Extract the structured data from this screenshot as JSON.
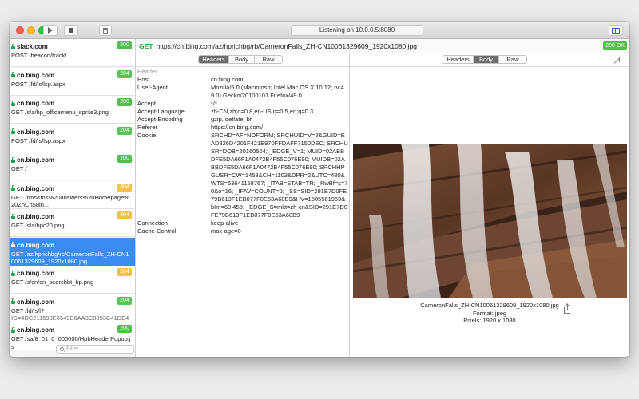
{
  "titlebar": {
    "status": "Listening on 10.0.0.5:8080",
    "icons": {
      "play": "play-icon",
      "stop": "stop-icon",
      "trash": "trash-icon",
      "split": "split-view-icon"
    }
  },
  "sidebar": {
    "items": [
      {
        "host": "slack.com",
        "path": "POST /beacon/track/",
        "status": "200",
        "secure": true
      },
      {
        "host": "cn.bing.com",
        "path": "POST /fd/ls/lsp.aspx",
        "status": "204",
        "secure": true
      },
      {
        "host": "cn.bing.com",
        "path": "GET /s/a/hp_officemenu_sprite3.png",
        "status": "200",
        "secure": true
      },
      {
        "host": "cn.bing.com",
        "path": "POST /fd/ls/lsp.aspx",
        "status": "204",
        "secure": true
      },
      {
        "host": "cn.bing.com",
        "path": "GET /",
        "status": "200",
        "secure": true
      },
      {
        "host": "cn.bing.com",
        "path": "GET /rms/rms%20answers%20Homepage%20ZhCn$8in...",
        "status": "304",
        "secure": true
      },
      {
        "host": "cn.bing.com",
        "path": "GET /s/a/hpc20.png",
        "status": "304",
        "secure": true
      },
      {
        "host": "cn.bing.com",
        "path": "GET /az/hprichbg/rb/CameronFalls_ZH-CN10061329609_1920x1080.jpg",
        "status": "200",
        "secure": true,
        "selected": true
      },
      {
        "host": "cn.bing.com",
        "path": "GET /s/cn/cn_searchbt_hp.png",
        "status": "304",
        "secure": true
      },
      {
        "host": "cn.bing.com",
        "path": "GET /fd/ls/l?",
        "path2": "IG=4DC211598E6549B6AA3C8893C41DE48...",
        "status": "204",
        "secure": true
      },
      {
        "host": "cn.bing.com",
        "path": "GET /sa/8_01_0_000000/HpbHeaderPopup.js",
        "status": "200",
        "secure": true
      }
    ],
    "filter_placeholder": "Filter"
  },
  "urlbar": {
    "method": "GET",
    "url": "https://cn.bing.com/az/hprichbg/rb/CameronFalls_ZH-CN10061329609_1920x1080.jpg",
    "status": "200 OK"
  },
  "request_pane": {
    "tabs": [
      "Headers",
      "Body",
      "Raw"
    ],
    "active_tab": "Headers",
    "section_label": "Header",
    "headers": [
      {
        "key": "Host",
        "value": "cn.bing.com"
      },
      {
        "key": "User-Agent",
        "value": "Mozilla/5.0 (Macintosh; Intel Mac OS X 10.12; rv:49.0) Gecko/20100101 Firefox/49.0"
      },
      {
        "key": "Accept",
        "value": "*/*"
      },
      {
        "key": "Accept-Language",
        "value": "zh-CN,zh;q=0.8,en-US;q=0.5,en;q=0.3"
      },
      {
        "key": "Accept-Encoding",
        "value": "gzip, deflate, br"
      },
      {
        "key": "Referer",
        "value": "https://cn.bing.com/"
      },
      {
        "key": "Cookie",
        "value": "SRCHD=AF=NOFORM; SRCHUID=V=2&GUID=EAD826D4201F421E970FFDAFF7150DEC; SRCHUSR=DOB=20160504; _EDGE_V=1; MUID=02ABBDFE5DA66F1A0472B4F55C076E90; MUIDB=02ABBDFE5DA66F1A0472B4F55C076E90; SRCHHPGUSR=CW=1458&CH=1103&DPR=2&UTC=480&WTS=63641158767; _ITAB=STAB=TR; _RwBf=s=70&o=16; _IFAV=COUNT=0; _SS=SID=291E7D0FE79B613F1EB077F0E63A60B9&HV=1505561969&bIm=60:458; _EDGE_S=mkt=zh-cn&SID=291E7D0FE79B613F1EB077F0E63A60B9"
      },
      {
        "key": "Connection",
        "value": "keep-alive"
      },
      {
        "key": "Cache-Control",
        "value": "max-age=0"
      }
    ]
  },
  "response_pane": {
    "tabs": [
      "Headers",
      "Body",
      "Raw"
    ],
    "active_tab": "Body",
    "image": {
      "name": "CameronFalls_ZH-CN10061329609_1920x1080.jpg",
      "format": "Format: jpeg",
      "pixels": "Pixels: 1920 x 1080"
    }
  },
  "colors": {
    "selection": "#3b8bf5",
    "status_ok": "#4fc04a",
    "status_304": "#f5c04a",
    "method_get": "#28a745"
  }
}
